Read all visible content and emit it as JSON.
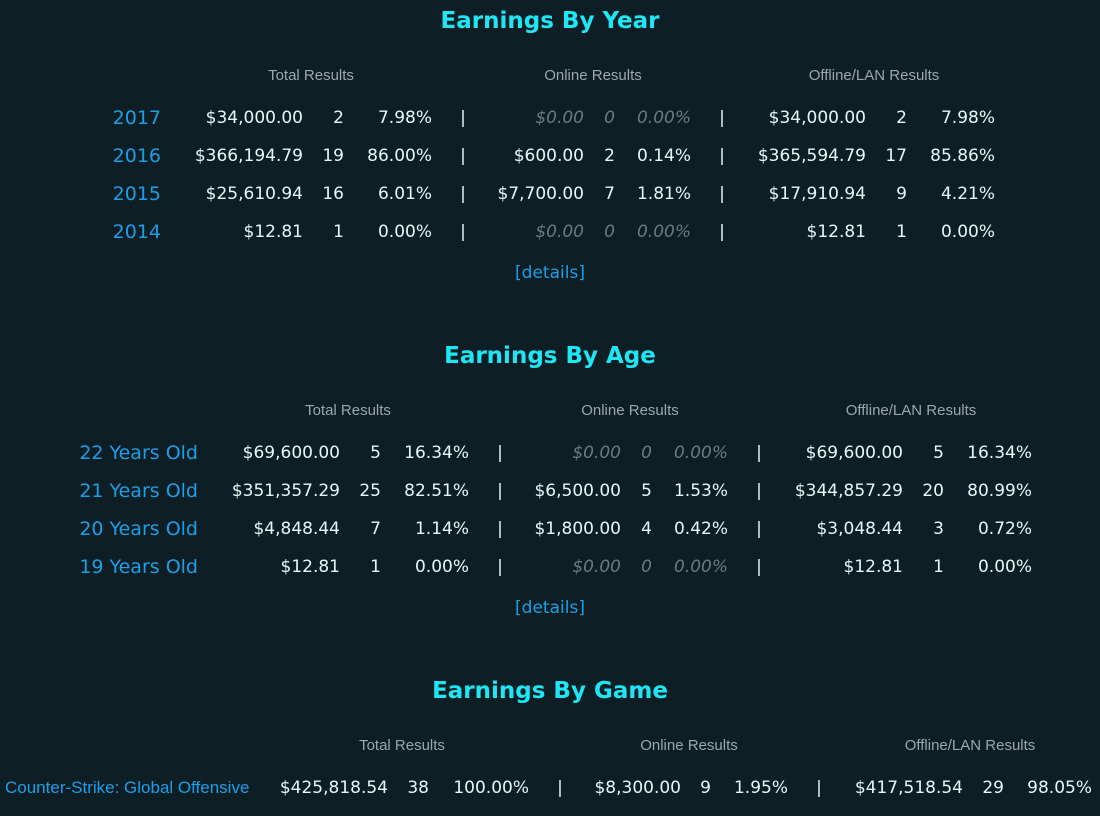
{
  "year": {
    "title": "Earnings By Year",
    "headers": {
      "total": "Total Results",
      "online": "Online Results",
      "offline": "Offline/LAN Results"
    },
    "separator": "|",
    "details": "[details]",
    "rows": [
      {
        "label": "2017",
        "total": "$34,000.00",
        "total_n": "2",
        "total_pct": "7.98%",
        "online": "$0.00",
        "online_n": "0",
        "online_pct": "0.00%",
        "offline": "$34,000.00",
        "offline_n": "2",
        "offline_pct": "7.98%"
      },
      {
        "label": "2016",
        "total": "$366,194.79",
        "total_n": "19",
        "total_pct": "86.00%",
        "online": "$600.00",
        "online_n": "2",
        "online_pct": "0.14%",
        "offline": "$365,594.79",
        "offline_n": "17",
        "offline_pct": "85.86%"
      },
      {
        "label": "2015",
        "total": "$25,610.94",
        "total_n": "16",
        "total_pct": "6.01%",
        "online": "$7,700.00",
        "online_n": "7",
        "online_pct": "1.81%",
        "offline": "$17,910.94",
        "offline_n": "9",
        "offline_pct": "4.21%"
      },
      {
        "label": "2014",
        "total": "$12.81",
        "total_n": "1",
        "total_pct": "0.00%",
        "online": "$0.00",
        "online_n": "0",
        "online_pct": "0.00%",
        "offline": "$12.81",
        "offline_n": "1",
        "offline_pct": "0.00%"
      }
    ]
  },
  "age": {
    "title": "Earnings By Age",
    "headers": {
      "total": "Total Results",
      "online": "Online Results",
      "offline": "Offline/LAN Results"
    },
    "separator": "|",
    "details": "[details]",
    "rows": [
      {
        "label": "22 Years Old",
        "total": "$69,600.00",
        "total_n": "5",
        "total_pct": "16.34%",
        "online": "$0.00",
        "online_n": "0",
        "online_pct": "0.00%",
        "offline": "$69,600.00",
        "offline_n": "5",
        "offline_pct": "16.34%"
      },
      {
        "label": "21 Years Old",
        "total": "$351,357.29",
        "total_n": "25",
        "total_pct": "82.51%",
        "online": "$6,500.00",
        "online_n": "5",
        "online_pct": "1.53%",
        "offline": "$344,857.29",
        "offline_n": "20",
        "offline_pct": "80.99%"
      },
      {
        "label": "20 Years Old",
        "total": "$4,848.44",
        "total_n": "7",
        "total_pct": "1.14%",
        "online": "$1,800.00",
        "online_n": "4",
        "online_pct": "0.42%",
        "offline": "$3,048.44",
        "offline_n": "3",
        "offline_pct": "0.72%"
      },
      {
        "label": "19 Years Old",
        "total": "$12.81",
        "total_n": "1",
        "total_pct": "0.00%",
        "online": "$0.00",
        "online_n": "0",
        "online_pct": "0.00%",
        "offline": "$12.81",
        "offline_n": "1",
        "offline_pct": "0.00%"
      }
    ]
  },
  "game": {
    "title": "Earnings By Game",
    "headers": {
      "total": "Total Results",
      "online": "Online Results",
      "offline": "Offline/LAN Results"
    },
    "separator": "|",
    "rows": [
      {
        "label": "Counter-Strike: Global Offensive",
        "total": "$425,818.54",
        "total_n": "38",
        "total_pct": "100.00%",
        "online": "$8,300.00",
        "online_n": "9",
        "online_pct": "1.95%",
        "offline": "$417,518.54",
        "offline_n": "29",
        "offline_pct": "98.05%"
      }
    ]
  },
  "colors": {
    "background": "#0d1f24",
    "title": "#1ee6f4",
    "link": "#1f9ee8",
    "value": "#e6f7f5",
    "header": "#9aa8ad",
    "zero": "#6b7b80"
  }
}
